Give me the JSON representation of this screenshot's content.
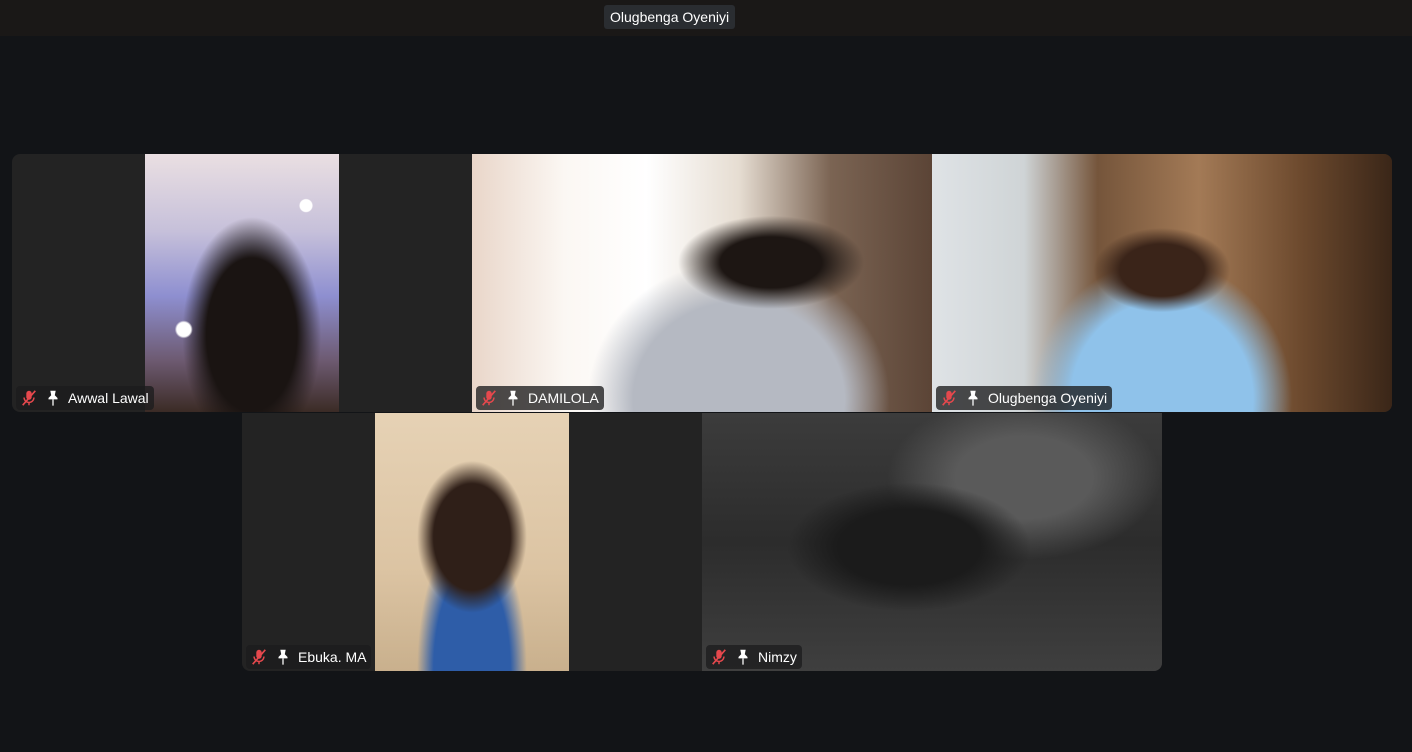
{
  "active_speaker": {
    "name": "Olugbenga Oyeniyi"
  },
  "participants": [
    {
      "name": "Awwal Lawal",
      "muted": true,
      "pinned": true
    },
    {
      "name": "DAMILOLA",
      "muted": true,
      "pinned": true
    },
    {
      "name": "Olugbenga Oyeniyi",
      "muted": true,
      "pinned": true
    },
    {
      "name": "Ebuka. MA",
      "muted": true,
      "pinned": true
    },
    {
      "name": "Nimzy",
      "muted": true,
      "pinned": true
    }
  ],
  "icons": {
    "mute": "mic-muted-icon",
    "pin": "pin-icon"
  },
  "colors": {
    "background": "#121417",
    "tile": "#232323",
    "mute_red": "#e5484d"
  }
}
